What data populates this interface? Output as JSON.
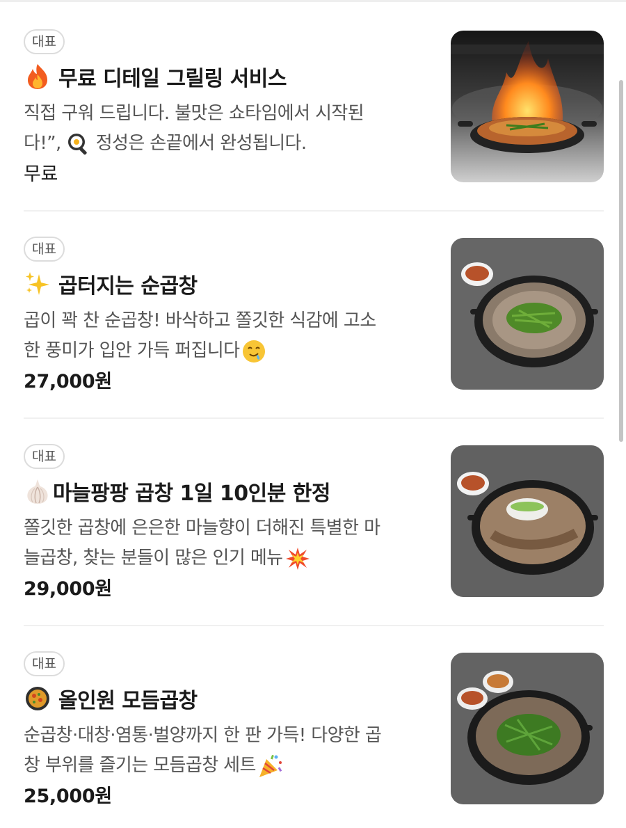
{
  "items": [
    {
      "badge": "대표",
      "emoji_icon": "fire-icon",
      "title": "무료 디테일 그릴링 서비스",
      "desc_line1": "직접 구워 드립니다. 불맛은 쇼타임에서 시작된",
      "desc_line2a": "다!”,",
      "desc_line2_icon": "frying-pan-icon",
      "desc_line2b": "정성은 손끝에서 완성됩니다.",
      "price": "무료"
    },
    {
      "badge": "대표",
      "emoji_icon": "sparkles-icon",
      "title": "곱터지는 순곱창",
      "desc_line1": "곱이 꽉 찬 순곱창! 바삭하고 쫄깃한 식감에 고소",
      "desc_line2a": "한 풍미가 입안 가득 퍼집니다",
      "desc_line2_icon": "drooling-face-icon",
      "price": "27,000원"
    },
    {
      "badge": "대표",
      "emoji_icon": "garlic-icon",
      "title": "마늘팡팡 곱창 1일 10인분 한정",
      "desc_line1": "쫄깃한 곱창에 은은한 마늘향이 더해진 특별한 마",
      "desc_line2a": "늘곱창, 찾는 분들이 많은 인기 메뉴",
      "desc_line2_icon": "collision-icon",
      "price": "29,000원"
    },
    {
      "badge": "대표",
      "emoji_icon": "paella-pan-icon",
      "title": "올인원 모듬곱창",
      "desc_line1": "순곱창·대창·염통·벌양까지 한 판 가득! 다양한 곱",
      "desc_line2a": "창 부위를 즐기는 모듬곱창 세트",
      "desc_line2_icon": "party-popper-icon",
      "price": "25,000원"
    }
  ]
}
